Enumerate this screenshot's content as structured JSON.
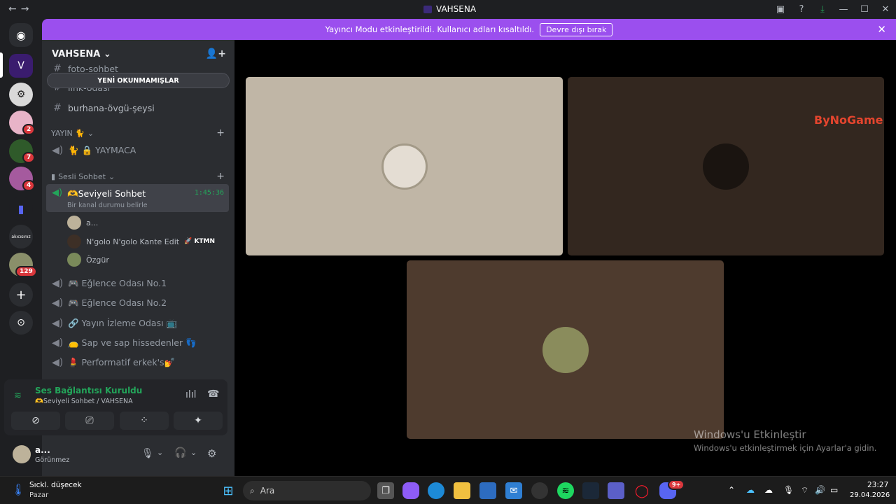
{
  "window": {
    "title": "VAHSENA"
  },
  "banner": {
    "text": "Yayıncı Modu etkinleştirildi. Kullanıcı adları kısaltıldı.",
    "button": "Devre dışı bırak"
  },
  "server": {
    "name": "VAHSENA"
  },
  "rail": {
    "badges": [
      "2",
      "7",
      "4",
      "129"
    ],
    "folder_label": "akıcısınız"
  },
  "sidebar": {
    "unread_pill": "YENİ OKUNMAMIŞLAR",
    "text_channels": [
      "foto-sohbet",
      "link-odası",
      "burhana-övgü-şeysi"
    ],
    "category_yayin": "YAYIN 🐈",
    "yaymaca": "🐈 🔒 YAYMACA",
    "category_sesli": "Sesli Sohbet",
    "active_voice": {
      "name": "🫶Seviyeli Sohbet",
      "status": "Bir kanal durumu belirle",
      "timer": "1:45:36"
    },
    "voice_users": [
      {
        "name": "a..."
      },
      {
        "name": "N'golo N'golo Kante Edit",
        "tag": "KTMN"
      },
      {
        "name": "Özgür"
      }
    ],
    "voice_channels": [
      "🎮 Eğlence Odası No.1",
      "🎮 Eğlence Odası No.2",
      "🔗 Yayın İzleme Odası 📺",
      "👝 Sap ve sap hissedenler 👣",
      "💄 Performatif erkek's💅"
    ]
  },
  "connection": {
    "title": "Ses Bağlantısı Kuruldu",
    "subtitle": "🫶Seviyeli Sohbet / VAHSENA"
  },
  "user": {
    "name": "a...",
    "status": "Görünmez"
  },
  "stage": {
    "watermark_brand": "ByNoGame"
  },
  "activation": {
    "title": "Windows'u Etkinleştir",
    "subtitle": "Windows'u etkinleştirmek için Ayarlar'a gidin."
  },
  "taskbar": {
    "weather_title": "Sıckl. düşecek",
    "weather_sub": "Pazar",
    "search_placeholder": "Ara",
    "time": "23:27",
    "date": "29.04.2026",
    "discord_badge": "9+"
  }
}
